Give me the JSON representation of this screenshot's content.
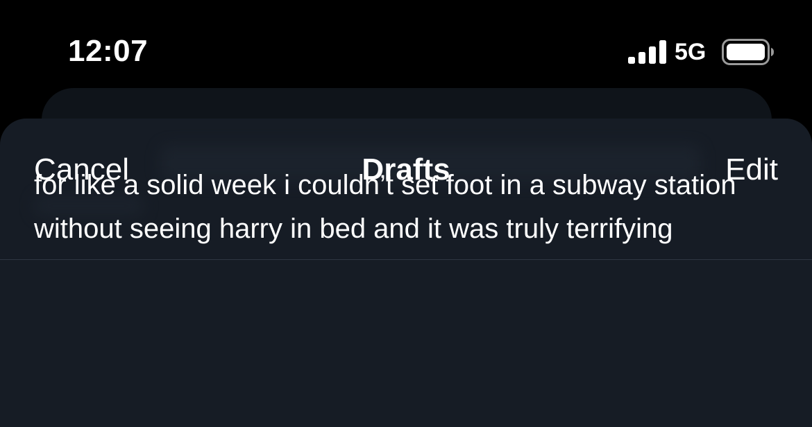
{
  "status_bar": {
    "time": "12:07",
    "network": "5G",
    "signal_icon": "cellular-signal-icon",
    "battery_icon": "battery-icon"
  },
  "nav": {
    "cancel_label": "Cancel",
    "title": "Drafts",
    "edit_label": "Edit"
  },
  "drafts": [
    {
      "text": "for like a solid week i couldn’t set foot in a subway station without seeing harry in bed and it was truly terrifying"
    }
  ],
  "colors": {
    "background": "#000000",
    "sheet": "#161c25",
    "text": "#ffffff",
    "divider": "#2f3742"
  }
}
